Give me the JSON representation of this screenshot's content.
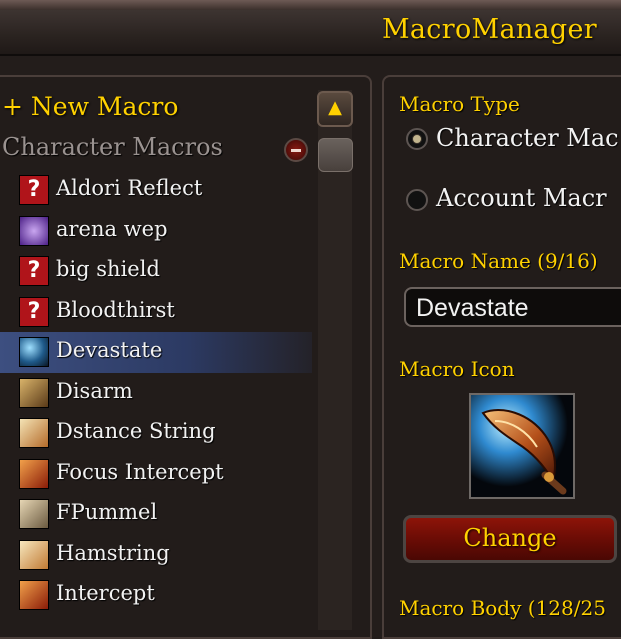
{
  "window": {
    "title": "MacroManager"
  },
  "list": {
    "new_macro_label": "+ New Macro",
    "group_header": "Character Macros",
    "items": [
      {
        "label": "Aldori Reflect",
        "icon": "question-mark-icon"
      },
      {
        "label": "arena wep",
        "icon": "purple-ability-icon"
      },
      {
        "label": "big shield",
        "icon": "question-mark-icon"
      },
      {
        "label": "Bloodthirst",
        "icon": "question-mark-icon"
      },
      {
        "label": "Devastate",
        "icon": "devastate-icon",
        "selected": true
      },
      {
        "label": "Disarm",
        "icon": "disarm-icon"
      },
      {
        "label": "Dstance String",
        "icon": "stance-icon"
      },
      {
        "label": "Focus Intercept",
        "icon": "intercept-icon"
      },
      {
        "label": "FPummel",
        "icon": "pummel-icon"
      },
      {
        "label": "Hamstring",
        "icon": "hamstring-icon"
      },
      {
        "label": "Intercept",
        "icon": "intercept-icon"
      }
    ]
  },
  "details": {
    "macro_type_label": "Macro Type",
    "type_character": "Character Mac",
    "type_account": "Account Macr",
    "selected_type": "character",
    "name_label": "Macro Name (9/16)",
    "name_value": "Devastate",
    "icon_label": "Macro Icon",
    "icon_name": "devastate-icon",
    "change_button": "Change",
    "body_label": "Macro Body (128/25"
  },
  "colors": {
    "gold": "#ffd100",
    "selected_row": "#3d4f80",
    "button_red": "#8d1409"
  }
}
